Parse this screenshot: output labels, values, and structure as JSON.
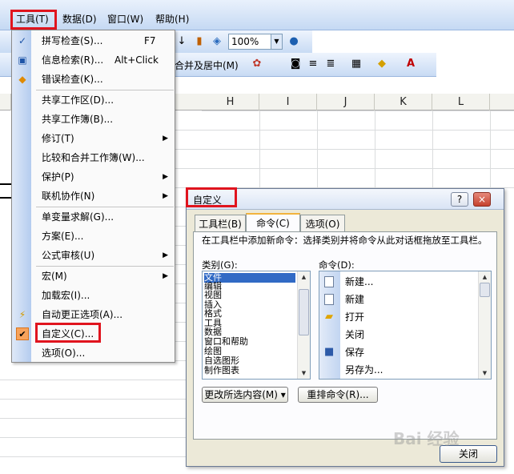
{
  "menubar": {
    "items": [
      "工具(T)",
      "数据(D)",
      "窗口(W)",
      "帮助(H)"
    ]
  },
  "toolbar": {
    "zoom": "100%",
    "merge_label": "合并及居中(M)"
  },
  "columns": [
    "H",
    "I",
    "J",
    "K",
    "L"
  ],
  "tools_menu": {
    "items": [
      {
        "label": "拼写检查(S)...",
        "shortcut": "F7",
        "icon": "spellcheck-icon"
      },
      {
        "label": "信息检索(R)...",
        "shortcut": "Alt+Click",
        "icon": "research-icon"
      },
      {
        "label": "错误检查(K)...",
        "icon": "error-check-icon"
      },
      {
        "label": "共享工作区(D)..."
      },
      {
        "label": "共享工作簿(B)..."
      },
      {
        "label": "修订(T)",
        "submenu": true
      },
      {
        "label": "比较和合并工作簿(W)..."
      },
      {
        "label": "保护(P)",
        "submenu": true
      },
      {
        "label": "联机协作(N)",
        "submenu": true
      },
      {
        "label": "单变量求解(G)..."
      },
      {
        "label": "方案(E)..."
      },
      {
        "label": "公式审核(U)",
        "submenu": true
      },
      {
        "label": "宏(M)",
        "submenu": true
      },
      {
        "label": "加载宏(I)..."
      },
      {
        "label": "自动更正选项(A)...",
        "icon": "autocorrect-icon"
      },
      {
        "label": "自定义(C)...",
        "icon": "checkmark-icon"
      },
      {
        "label": "选项(O)..."
      }
    ]
  },
  "dialog": {
    "title": "自定义",
    "help_btn": "?",
    "close_btn": "×",
    "tabs": [
      "工具栏(B)",
      "命令(C)",
      "选项(O)"
    ],
    "instruction": "在工具栏中添加新命令：选择类别并将命令从此对话框拖放至工具栏。",
    "categories_label": "类别(G):",
    "commands_label": "命令(D):",
    "categories": [
      "文件",
      "编辑",
      "视图",
      "插入",
      "格式",
      "工具",
      "数据",
      "窗口和帮助",
      "绘图",
      "自选图形",
      "制作图表"
    ],
    "selected_category": "文件",
    "commands": [
      {
        "label": "新建...",
        "icon": "new-doc-icon"
      },
      {
        "label": "新建",
        "icon": "new-doc-icon"
      },
      {
        "label": "打开",
        "icon": "open-folder-icon"
      },
      {
        "label": "关闭",
        "icon": ""
      },
      {
        "label": "保存",
        "icon": "save-icon"
      },
      {
        "label": "另存为...",
        "icon": ""
      }
    ],
    "modify_button": "更改所选内容(M) ▾",
    "rearrange_button": "重排命令(R)...",
    "close_button": "关闭"
  },
  "watermark": "Bai 经验"
}
